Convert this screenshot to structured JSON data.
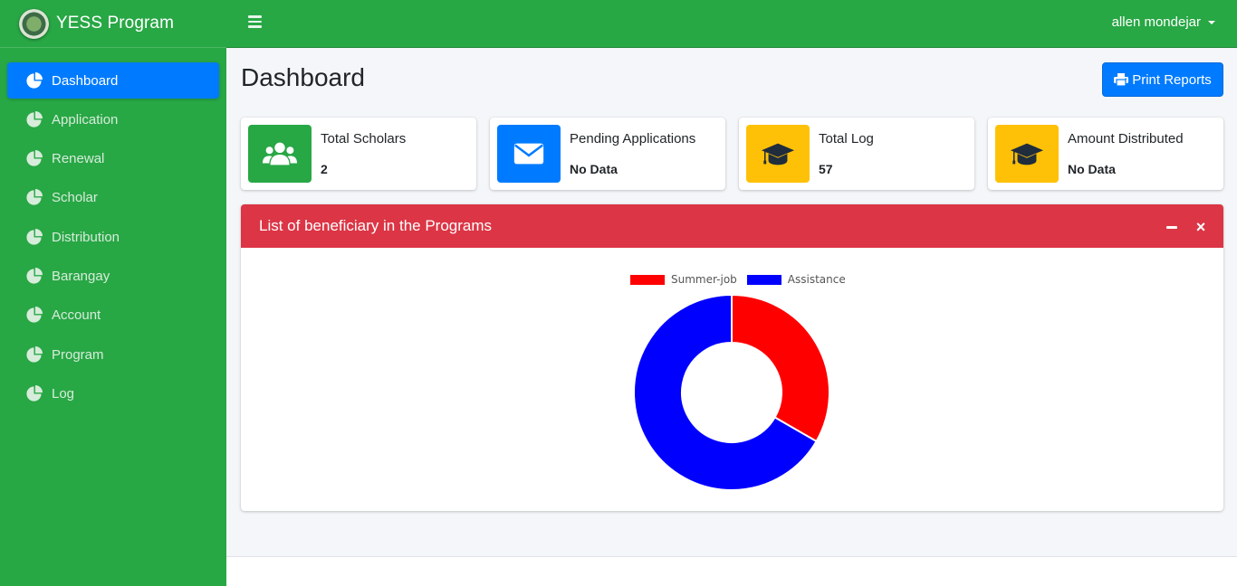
{
  "brand": {
    "name": "YESS Program"
  },
  "topbar": {
    "user_name": "allen mondejar",
    "menu_icon": "bars-icon"
  },
  "sidebar": {
    "items": [
      {
        "label": "Dashboard",
        "active": true,
        "icon": "pie-chart-icon"
      },
      {
        "label": "Application",
        "active": false,
        "icon": "pie-chart-icon"
      },
      {
        "label": "Renewal",
        "active": false,
        "icon": "pie-chart-icon"
      },
      {
        "label": "Scholar",
        "active": false,
        "icon": "pie-chart-icon"
      },
      {
        "label": "Distribution",
        "active": false,
        "icon": "pie-chart-icon"
      },
      {
        "label": "Barangay",
        "active": false,
        "icon": "pie-chart-icon"
      },
      {
        "label": "Account",
        "active": false,
        "icon": "pie-chart-icon"
      },
      {
        "label": "Program",
        "active": false,
        "icon": "pie-chart-icon"
      },
      {
        "label": "Log",
        "active": false,
        "icon": "pie-chart-icon"
      }
    ]
  },
  "page": {
    "title": "Dashboard",
    "print_label": "Print Reports"
  },
  "stats": [
    {
      "label": "Total Scholars",
      "value": "2",
      "icon": "users-icon",
      "color": "#28a745"
    },
    {
      "label": "Pending Applications",
      "value": "No Data",
      "icon": "envelope-icon",
      "color": "#007bff"
    },
    {
      "label": "Total Log",
      "value": "57",
      "icon": "graduation-cap-icon",
      "color": "#ffc107"
    },
    {
      "label": "Amount Distributed",
      "value": "No Data",
      "icon": "graduation-cap-icon",
      "color": "#ffc107"
    }
  ],
  "card": {
    "title": "List of beneficiary in the Programs"
  },
  "chart_data": {
    "type": "pie",
    "variant": "doughnut",
    "legend_position": "top",
    "series": [
      {
        "name": "Summer-job",
        "value": 1,
        "color": "#ff0000"
      },
      {
        "name": "Assistance",
        "value": 2,
        "color": "#0000ff"
      }
    ]
  },
  "colors": {
    "sidebar": "#28a745",
    "active": "#007bff",
    "card_header": "#dc3545",
    "warning": "#ffc107"
  }
}
